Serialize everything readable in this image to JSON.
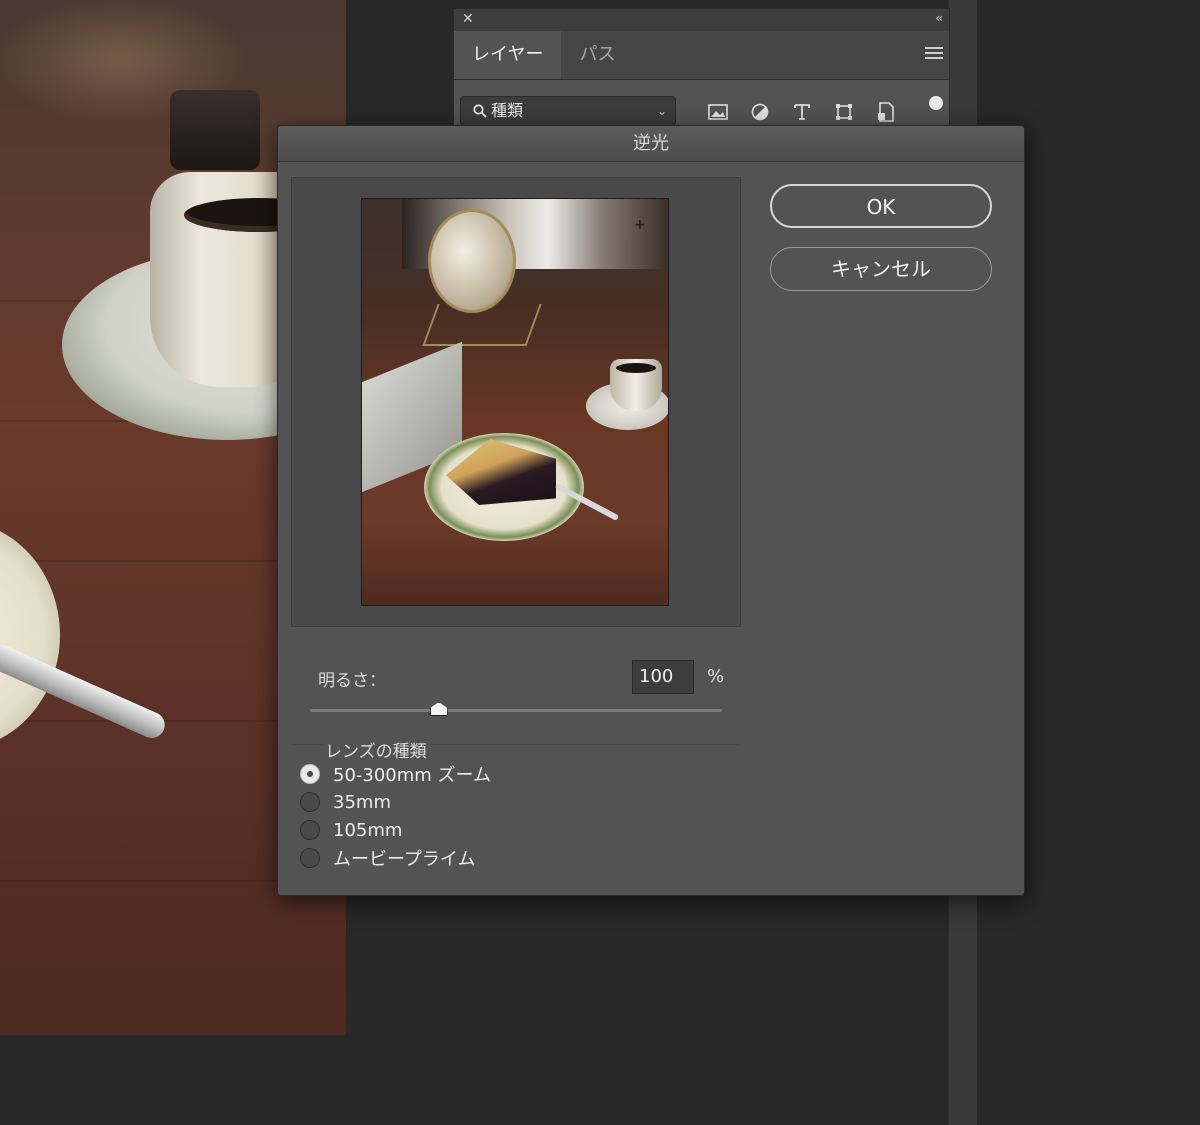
{
  "layers_panel": {
    "close_glyph": "✕",
    "collapse_glyph": "‹‹",
    "tabs": [
      {
        "label": "レイヤー",
        "active": true
      },
      {
        "label": "パス",
        "active": false
      }
    ],
    "filter_label": "種類",
    "icons": [
      "image-icon",
      "adjustment-icon",
      "type-icon",
      "shape-icon",
      "smart-object-icon"
    ]
  },
  "dialog": {
    "title": "逆光",
    "ok_label": "OK",
    "cancel_label": "キャンセル",
    "brightness": {
      "label": "明るさ：",
      "value": "100",
      "unit": "%",
      "slider_fraction": 0.31
    },
    "lens": {
      "legend": "レンズの種類",
      "options": [
        {
          "label": "50-300mm ズーム",
          "checked": true
        },
        {
          "label": "35mm",
          "checked": false
        },
        {
          "label": "105mm",
          "checked": false
        },
        {
          "label": "ムービープライム",
          "checked": false
        }
      ]
    }
  }
}
